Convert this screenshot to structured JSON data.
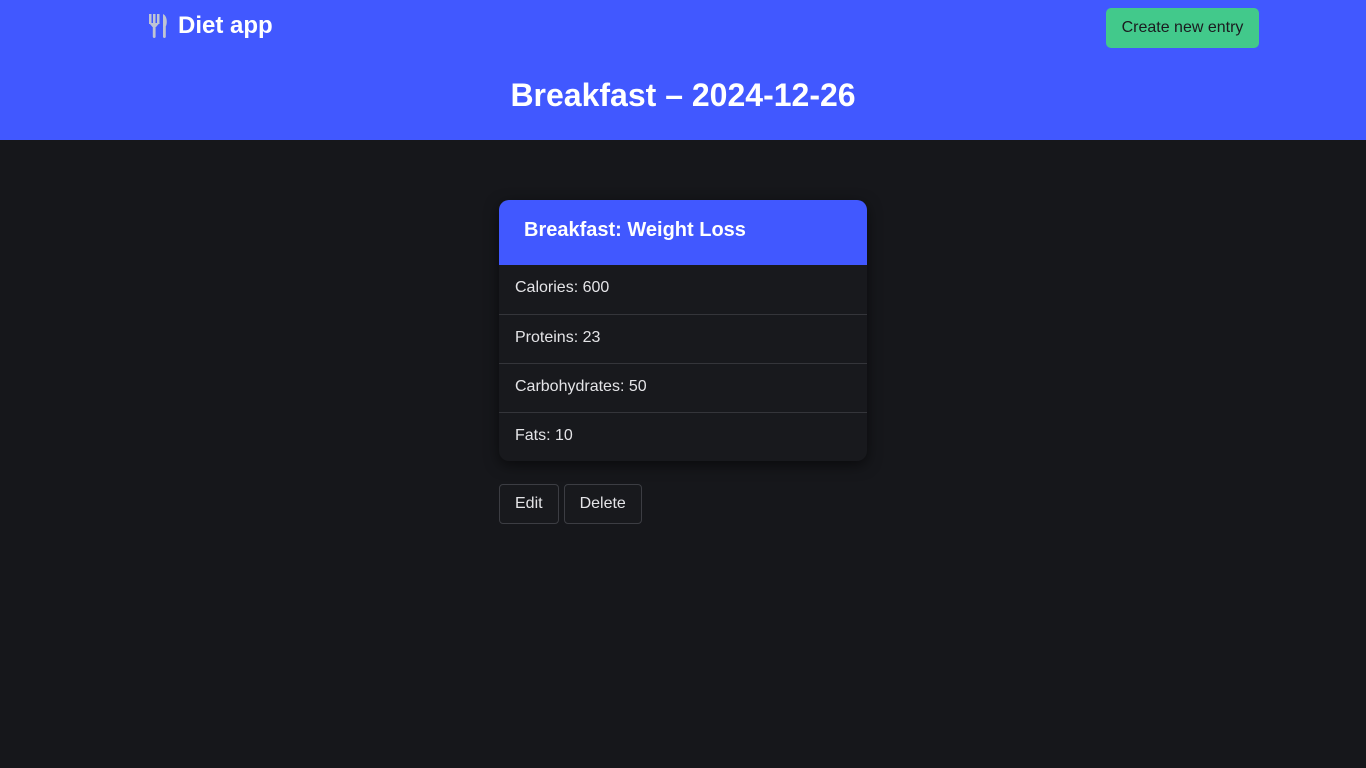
{
  "header": {
    "brand_text": "Diet app",
    "brand_icon": "fork-knife-icon",
    "create_button_label": "Create new entry",
    "page_title": "Breakfast – 2024-12-26"
  },
  "card": {
    "title": "Breakfast: Weight Loss",
    "rows": [
      {
        "label": "Calories: 600"
      },
      {
        "label": "Proteins: 23"
      },
      {
        "label": "Carbohydrates: 50"
      },
      {
        "label": "Fats: 10"
      }
    ]
  },
  "actions": {
    "edit_label": "Edit",
    "delete_label": "Delete"
  },
  "colors": {
    "primary": "#4158ff",
    "accent": "#42c98b",
    "background": "#16171b"
  }
}
